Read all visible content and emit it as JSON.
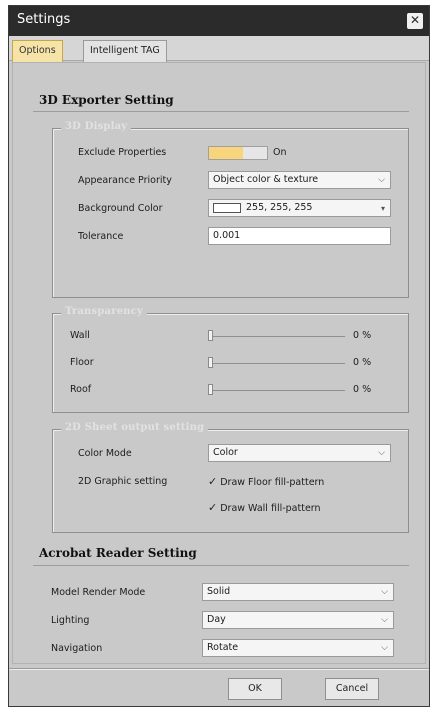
{
  "window": {
    "title": "Settings",
    "close_icon": "close-icon"
  },
  "tabs": [
    {
      "label": "Options",
      "active": true
    },
    {
      "label": "Intelligent TAG",
      "active": false
    }
  ],
  "exporter": {
    "title": "3D Exporter Setting",
    "display": {
      "legend": "3D Display",
      "exclude_label": "Exclude Properties",
      "exclude_value": "On",
      "appearance_label": "Appearance Priority",
      "appearance_value": "Object color & texture",
      "background_label": "Background Color",
      "background_value": "255, 255, 255",
      "tolerance_label": "Tolerance",
      "tolerance_value": "0.001"
    },
    "transparency": {
      "legend": "Transparency",
      "items": [
        {
          "label": "Wall",
          "value": "0 %",
          "level": 0
        },
        {
          "label": "Floor",
          "value": "0 %",
          "level": 0
        },
        {
          "label": "Roof",
          "value": "0 %",
          "level": 0
        }
      ]
    },
    "sheet": {
      "legend": "2D Sheet output setting",
      "color_mode_label": "Color Mode",
      "color_mode_value": "Color",
      "graphic_label": "2D Graphic setting",
      "check_floor": "Draw Floor fill-pattern",
      "check_wall": "Draw Wall fill-pattern"
    }
  },
  "acrobat": {
    "title": "Acrobat Reader Setting",
    "render_label": "Model Render Mode",
    "render_value": "Solid",
    "lighting_label": "Lighting",
    "lighting_value": "Day",
    "navigation_label": "Navigation",
    "navigation_value": "Rotate"
  },
  "buttons": {
    "ok": "OK",
    "cancel": "Cancel"
  },
  "colors": {
    "titlebar": "#2b2b2b",
    "panel": "#c9c9c9",
    "accent": "#f8d47c"
  }
}
